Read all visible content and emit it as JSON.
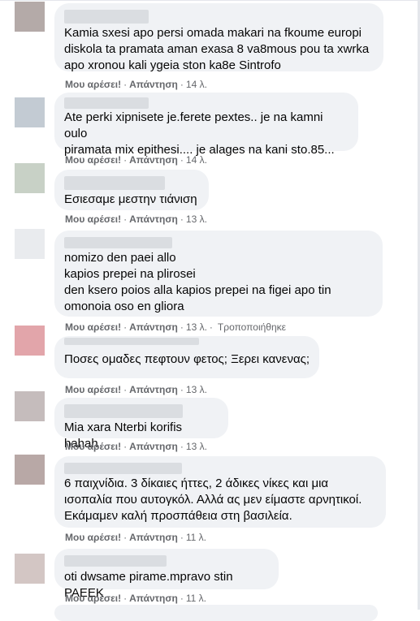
{
  "actions": {
    "like": "Μου αρέσει!",
    "reply": "Απάντηση",
    "sep": "·"
  },
  "comments": [
    {
      "text": "Kamia sxesi apo persi omada makari na fkoume europi\ndiskola ta pramata aman exasa 8 va8mous pou ta xwrka\napo xronou kali ygeia ston ka8e Sintrofo",
      "time": "14 λ."
    },
    {
      "text": "Ate perki xipnisete je.ferete pextes.. je na kamni oulo\npiramata mix epithesi.... je alages na kani sto.85...",
      "time": "14 λ."
    },
    {
      "text": "Εσιεσαμε μεστην τιάνιση",
      "time": "13 λ."
    },
    {
      "text": "nomizo den paei allo\nkapios prepei na plirosei\nden ksero poios alla kapios prepei na figei apo tin\nomonoia oso en gliora",
      "time": "13 λ.",
      "edited": "Τροποποιήθηκε"
    },
    {
      "text": "Ποσες ομαδες πεφτουν φετος; Ξερει κανενας;",
      "time": "13 λ."
    },
    {
      "text": "Mia xara Nterbi korifis hahah",
      "time": "13 λ."
    },
    {
      "text": "6 παιχνίδια. 3 δίκαιες ήττες, 2 άδικες νίκες και μια\nισοπαλία που αυτογκόλ. Αλλά ας μεν είμαστε αρνητικοί.\nΕκάμαμεν καλή προσπάθεια στη βασιλεία.",
      "time": "11 λ."
    },
    {
      "text": "oti dwsame pirame.mpravo stin PAEEK",
      "time": "11 λ."
    }
  ]
}
